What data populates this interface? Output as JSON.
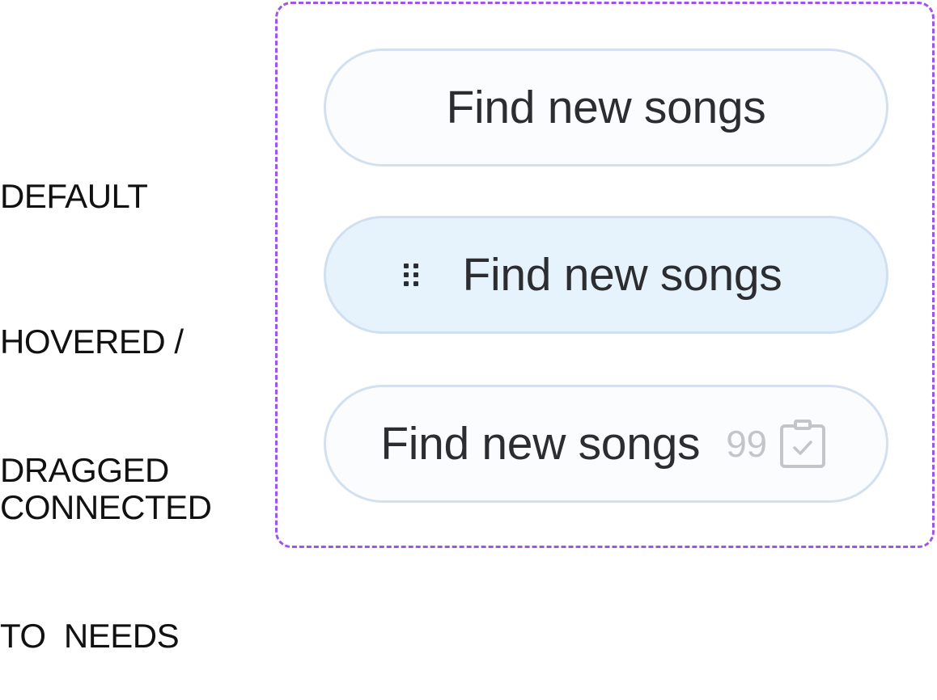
{
  "labels": {
    "default": [
      "DEFAULT"
    ],
    "hovered": [
      "HOVERED /",
      "DRAGGED"
    ],
    "connected": [
      "CONNECTED",
      "TO  NEEDS"
    ]
  },
  "pills": {
    "default": {
      "text": "Find new songs"
    },
    "hovered": {
      "text": "Find new songs",
      "icon": "drag-handle-icon"
    },
    "connected": {
      "text": "Find new songs",
      "count": "99",
      "icon": "clipboard-check-icon"
    }
  },
  "colors": {
    "frame_border": "#9f55ea",
    "pill_border": "#d3e0ef",
    "pill_bg": "#fbfcfe",
    "pill_hover_bg": "#e6f2fc",
    "text": "#2b2d31",
    "muted": "#c3c5c9"
  }
}
